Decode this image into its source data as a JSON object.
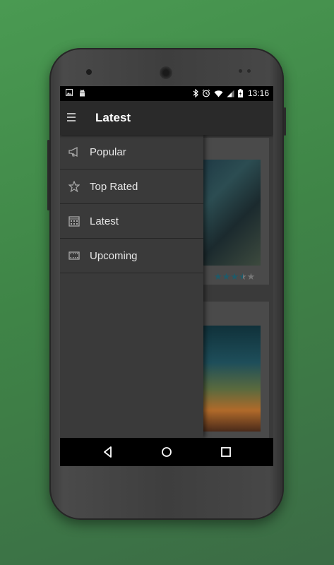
{
  "status_bar": {
    "time": "13:16",
    "left_icons": [
      "image-icon",
      "android-icon"
    ],
    "right_icons": [
      "bluetooth-icon",
      "alarm-icon",
      "wifi-icon",
      "signal-icon",
      "battery-charging-icon"
    ]
  },
  "toolbar": {
    "menu_icon": "hamburger-icon",
    "title": "Latest"
  },
  "drawer": {
    "items": [
      {
        "label": "Popular",
        "icon": "megaphone-icon"
      },
      {
        "label": "Top Rated",
        "icon": "star-icon"
      },
      {
        "label": "Latest",
        "icon": "calendar-icon"
      },
      {
        "label": "Upcoming",
        "icon": "film-icon"
      }
    ]
  },
  "content": {
    "cards": [
      {
        "rating_stars": 3.5,
        "max_stars": 5
      },
      {
        "rating_stars": null
      }
    ]
  },
  "nav_bar": {
    "back": "back-icon",
    "home": "home-icon",
    "recents": "recents-icon"
  },
  "colors": {
    "background": "#4a9a52",
    "drawer": "#3a3a3a",
    "star_active": "#1e5b6a"
  }
}
